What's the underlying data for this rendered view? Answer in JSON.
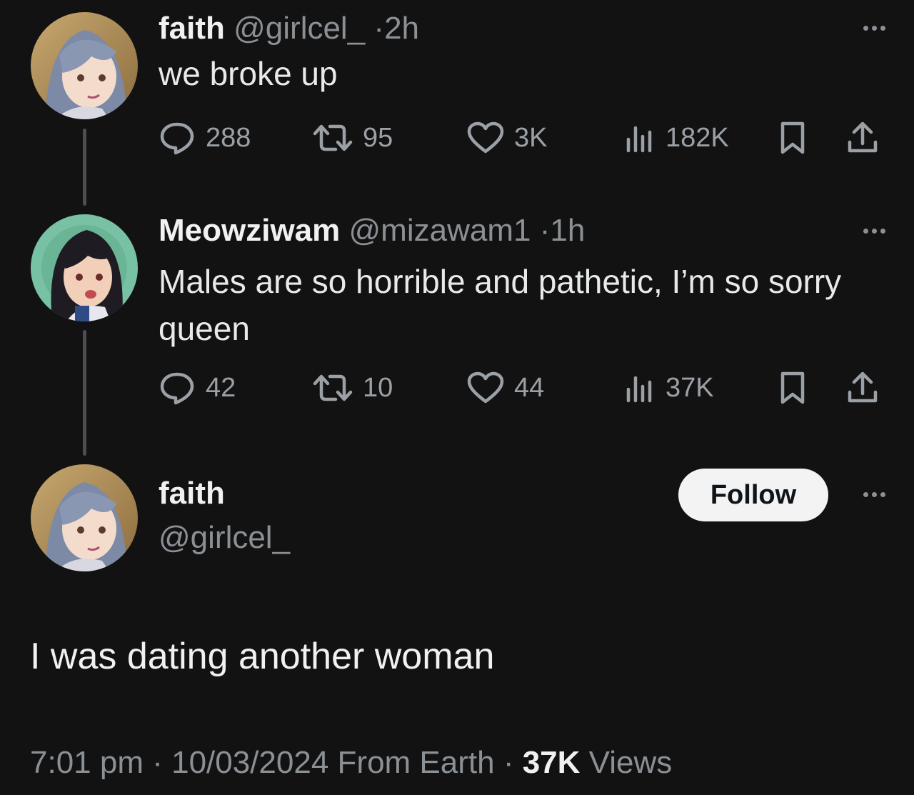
{
  "colors": {
    "background": "#121212",
    "text_primary": "#e7e9ea",
    "text_secondary": "#8b9095",
    "thread_line": "#4a4f53",
    "follow_bg": "#f3f3f3"
  },
  "tweets": [
    {
      "display_name": "faith",
      "handle": "@girlcel_",
      "separator": "·",
      "time": "2h",
      "text": "we broke up",
      "actions": {
        "replies": "288",
        "reposts": "95",
        "likes": "3K",
        "views": "182K"
      }
    },
    {
      "display_name": "Meowziwam",
      "handle": "@mizawam1",
      "separator": "·",
      "time": "1h",
      "text": "Males are so horrible and pathetic, I’m so sorry queen",
      "actions": {
        "replies": "42",
        "reposts": "10",
        "likes": "44",
        "views": "37K"
      }
    }
  ],
  "main_tweet": {
    "display_name": "faith",
    "handle": "@girlcel_",
    "follow_label": "Follow",
    "text": "I was dating another woman",
    "meta": {
      "time": "7:01 pm",
      "separator1": " · ",
      "date": "10/03/2024",
      "source": " From Earth",
      "separator2": " · ",
      "views_count": "37K",
      "views_label": " Views"
    }
  },
  "icons": [
    "more-icon",
    "reply-icon",
    "repost-icon",
    "like-icon",
    "views-icon",
    "bookmark-icon",
    "share-icon"
  ]
}
